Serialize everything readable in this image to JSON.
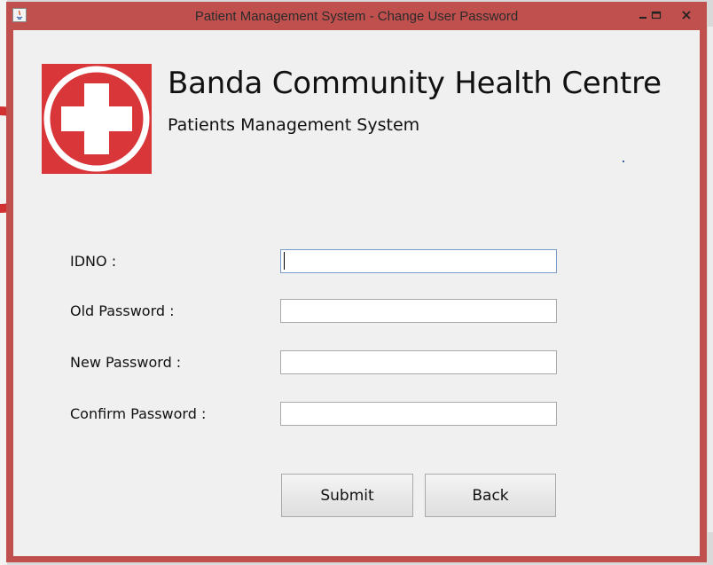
{
  "window": {
    "title": "Patient Management System - Change User Password",
    "icons": {
      "app": "java-app-icon",
      "minimize": "minimize-icon",
      "maximize": "maximize-icon",
      "close": "close-icon"
    }
  },
  "header": {
    "logo_icon": "red-cross-icon",
    "org_name": "Banda Community Health Centre",
    "system_name": "Patients Management System"
  },
  "form": {
    "idno": {
      "label": "IDNO :",
      "value": ""
    },
    "old_password": {
      "label": "Old Password :",
      "value": ""
    },
    "new_password": {
      "label": "New Password :",
      "value": ""
    },
    "confirm_password": {
      "label": "Confirm Password :",
      "value": ""
    }
  },
  "buttons": {
    "submit": "Submit",
    "back": "Back"
  },
  "colors": {
    "frame": "#c0504d",
    "logo_red": "#d9363a",
    "client_bg": "#f0f0f0"
  }
}
